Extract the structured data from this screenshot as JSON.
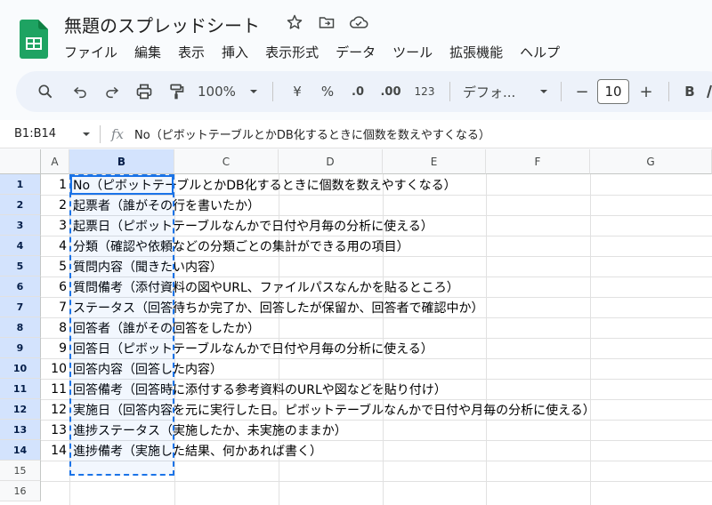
{
  "doc": {
    "title": "無題のスプレッドシート"
  },
  "menu": [
    "ファイル",
    "編集",
    "表示",
    "挿入",
    "表示形式",
    "データ",
    "ツール",
    "拡張機能",
    "ヘルプ"
  ],
  "toolbar": {
    "zoom": "100%",
    "currency": "¥",
    "percent": "%",
    "decrease_decimal": ".0",
    "increase_decimal": ".00",
    "number_format": "123",
    "font": "デフォ...",
    "minus": "−",
    "font_size": "10",
    "plus": "+",
    "bold": "B"
  },
  "formula_bar": {
    "name_box": "B1:B14",
    "fx": "fx",
    "content": "No（ピボットテーブルとかDB化するときに個数を数えやすくなる）"
  },
  "columns": [
    "A",
    "B",
    "C",
    "D",
    "E",
    "F",
    "G"
  ],
  "rows": [
    {
      "num": "1",
      "a": "1",
      "b": "No（ピボットテーブルとかDB化するときに個数を数えやすくなる）"
    },
    {
      "num": "2",
      "a": "2",
      "b": "起票者（誰がその行を書いたか）"
    },
    {
      "num": "3",
      "a": "3",
      "b": "起票日（ピボットテーブルなんかで日付や月毎の分析に使える）"
    },
    {
      "num": "4",
      "a": "4",
      "b": "分類（確認や依頼などの分類ごとの集計ができる用の項目）"
    },
    {
      "num": "5",
      "a": "5",
      "b": "質問内容（聞きたい内容）"
    },
    {
      "num": "6",
      "a": "6",
      "b": "質問備考（添付資料の図やURL、ファイルパスなんかを貼るところ）"
    },
    {
      "num": "7",
      "a": "7",
      "b": "ステータス（回答待ちか完了か、回答したが保留か、回答者で確認中か）"
    },
    {
      "num": "8",
      "a": "8",
      "b": "回答者（誰がその回答をしたか）"
    },
    {
      "num": "9",
      "a": "9",
      "b": "回答日（ピボットテーブルなんかで日付や月毎の分析に使える）"
    },
    {
      "num": "10",
      "a": "10",
      "b": "回答内容（回答した内容）"
    },
    {
      "num": "11",
      "a": "11",
      "b": "回答備考（回答時に添付する参考資料のURLや図などを貼り付け）"
    },
    {
      "num": "12",
      "a": "12",
      "b": "実施日（回答内容を元に実行した日。ピボットテーブルなんかで日付や月毎の分析に使える）"
    },
    {
      "num": "13",
      "a": "13",
      "b": "進捗ステータス（実施したか、未実施のままか）"
    },
    {
      "num": "14",
      "a": "14",
      "b": "進捗備考（実施した結果、何かあれば書く）"
    },
    {
      "num": "15",
      "a": "",
      "b": ""
    },
    {
      "num": "16",
      "a": "",
      "b": ""
    }
  ]
}
